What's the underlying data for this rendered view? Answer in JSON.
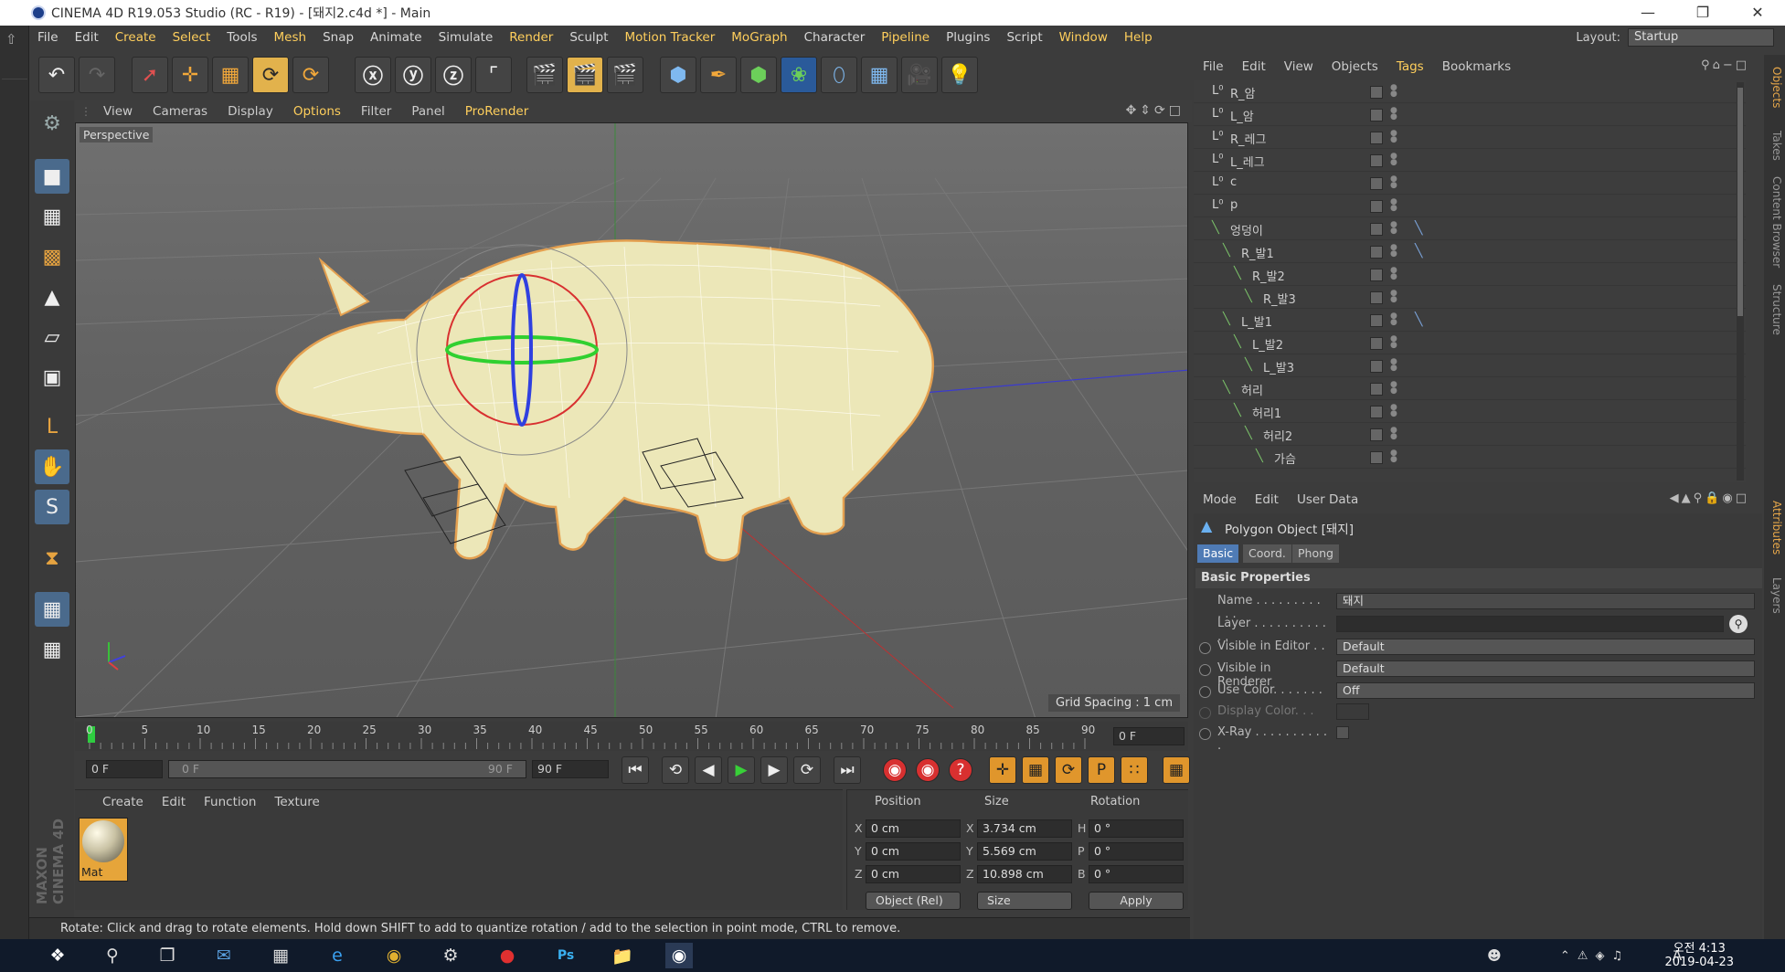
{
  "window": {
    "title": "CINEMA 4D R19.053 Studio (RC - R19) - [돼지2.c4d *] - Main"
  },
  "menu": [
    "File",
    "Edit",
    "Create",
    "Select",
    "Tools",
    "Mesh",
    "Snap",
    "Animate",
    "Simulate",
    "Render",
    "Sculpt",
    "Motion Tracker",
    "MoGraph",
    "Character",
    "Pipeline",
    "Plugins",
    "Script",
    "Window",
    "Help"
  ],
  "layout": {
    "label": "Layout:",
    "value": "Startup"
  },
  "viewport": {
    "menu": [
      "View",
      "Cameras",
      "Display",
      "Options",
      "Filter",
      "Panel",
      "ProRender"
    ],
    "label": "Perspective",
    "grid_spacing": "Grid Spacing : 1 cm"
  },
  "timeline": {
    "ticks": [
      "0",
      "5",
      "10",
      "15",
      "20",
      "25",
      "30",
      "35",
      "40",
      "45",
      "50",
      "55",
      "60",
      "65",
      "70",
      "75",
      "80",
      "85",
      "90"
    ],
    "frame": "0 F",
    "start": "0 F",
    "range_left": "0 F",
    "range_right": "90 F",
    "end": "90 F"
  },
  "materials": {
    "menu": [
      "Create",
      "Edit",
      "Function",
      "Texture"
    ],
    "items": [
      {
        "name": "Mat"
      }
    ]
  },
  "coords": {
    "headers": [
      "Position",
      "Size",
      "Rotation"
    ],
    "rows": [
      {
        "a": "X",
        "pos": "0 cm",
        "s": "X",
        "size": "3.734 cm",
        "r": "H",
        "rot": "0 °"
      },
      {
        "a": "Y",
        "pos": "0 cm",
        "s": "Y",
        "size": "5.569 cm",
        "r": "P",
        "rot": "0 °"
      },
      {
        "a": "Z",
        "pos": "0 cm",
        "s": "Z",
        "size": "10.898 cm",
        "r": "B",
        "rot": "0 °"
      }
    ],
    "mode": "Object (Rel)",
    "size_mode": "Size",
    "apply": "Apply"
  },
  "status": "Rotate: Click and drag to rotate elements. Hold down SHIFT to add to quantize rotation / add to the selection in point mode, CTRL to remove.",
  "objects": {
    "menu": [
      "File",
      "Edit",
      "View",
      "Objects",
      "Tags",
      "Bookmarks"
    ],
    "rows": [
      {
        "name": "R_암",
        "type": "null",
        "tag": ""
      },
      {
        "name": "L_암",
        "type": "null",
        "tag": ""
      },
      {
        "name": "R_레그",
        "type": "null",
        "tag": ""
      },
      {
        "name": "L_레그",
        "type": "null",
        "tag": ""
      },
      {
        "name": "c",
        "type": "null",
        "tag": ""
      },
      {
        "name": "p",
        "type": "null",
        "tag": ""
      },
      {
        "name": "엉덩이",
        "type": "bone",
        "tag": "ik"
      },
      {
        "name": "R_발1",
        "type": "bone",
        "tag": "ik"
      },
      {
        "name": "R_발2",
        "type": "bone",
        "tag": ""
      },
      {
        "name": "R_발3",
        "type": "bone",
        "tag": ""
      },
      {
        "name": "L_발1",
        "type": "bone",
        "tag": "ik"
      },
      {
        "name": "L_발2",
        "type": "bone",
        "tag": ""
      },
      {
        "name": "L_발3",
        "type": "bone",
        "tag": ""
      },
      {
        "name": "허리",
        "type": "bone",
        "tag": ""
      },
      {
        "name": "허리1",
        "type": "bone",
        "tag": ""
      },
      {
        "name": "허리2",
        "type": "bone",
        "tag": ""
      },
      {
        "name": "가슴",
        "type": "bone",
        "tag": ""
      }
    ]
  },
  "attributes": {
    "menu": [
      "Mode",
      "Edit",
      "User Data"
    ],
    "title": "Polygon Object [돼지]",
    "tabs": [
      "Basic",
      "Coord.",
      "Phong"
    ],
    "section": "Basic Properties",
    "props": [
      {
        "label": "Name . . . . . . . . . . . .",
        "value": "돼지"
      },
      {
        "label": "Layer . . . . . . . . . . . .",
        "value": ""
      },
      {
        "label": "Visible in Editor . .",
        "value": "Default"
      },
      {
        "label": "Visible in Renderer",
        "value": "Default"
      },
      {
        "label": "Use Color. . . . . . . .",
        "value": "Off"
      },
      {
        "label": "Display Color. . .",
        "value": ""
      },
      {
        "label": "X-Ray . . . . . . . . . . .",
        "value": ""
      }
    ]
  },
  "right_tabs": [
    "Objects",
    "Takes",
    "Content Browser",
    "Structure",
    "Attributes",
    "Layers"
  ],
  "taskbar": {
    "time": "오전 4:13",
    "date": "2019-04-23",
    "edge_clock": ":13"
  },
  "brand": "MAXON CINEMA 4D"
}
